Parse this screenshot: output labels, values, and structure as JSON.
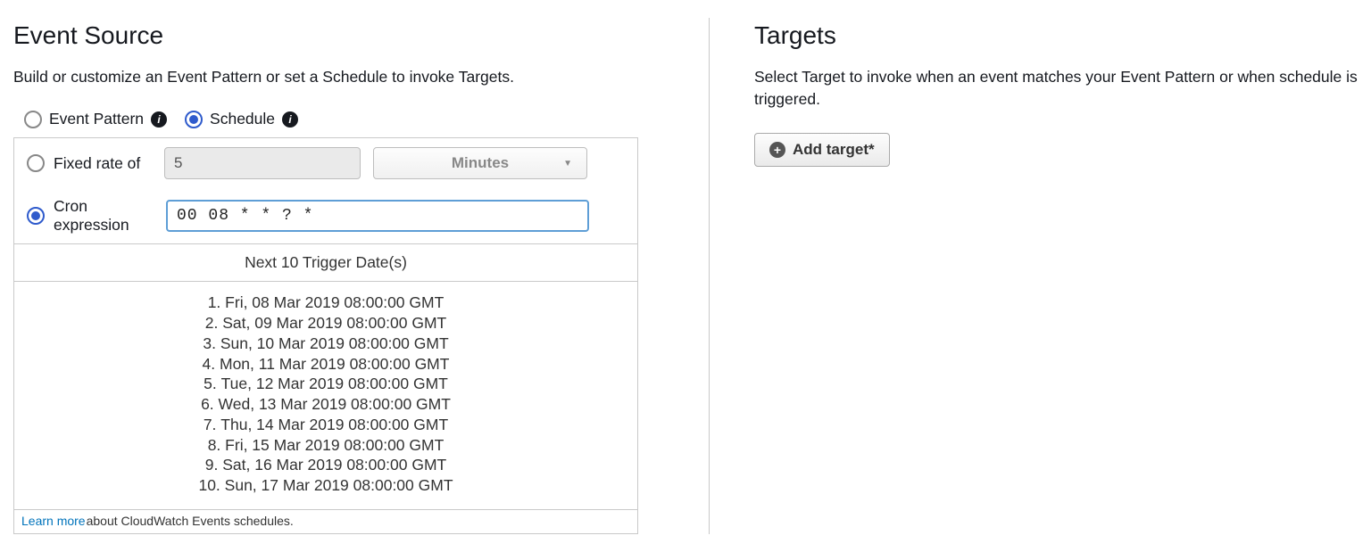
{
  "eventSource": {
    "title": "Event Source",
    "description": "Build or customize an Event Pattern or set a Schedule to invoke Targets.",
    "patternLabel": "Event Pattern",
    "scheduleLabel": "Schedule",
    "fixedRateLabel": "Fixed rate of",
    "fixedRateValue": "5",
    "fixedRateUnit": "Minutes",
    "cronLabel": "Cron expression",
    "cronValue": "00 08 * * ? *",
    "triggersHeader": "Next 10 Trigger Date(s)",
    "triggers": [
      "Fri, 08 Mar 2019 08:00:00 GMT",
      "Sat, 09 Mar 2019 08:00:00 GMT",
      "Sun, 10 Mar 2019 08:00:00 GMT",
      "Mon, 11 Mar 2019 08:00:00 GMT",
      "Tue, 12 Mar 2019 08:00:00 GMT",
      "Wed, 13 Mar 2019 08:00:00 GMT",
      "Thu, 14 Mar 2019 08:00:00 GMT",
      "Fri, 15 Mar 2019 08:00:00 GMT",
      "Sat, 16 Mar 2019 08:00:00 GMT",
      "Sun, 17 Mar 2019 08:00:00 GMT"
    ],
    "learnMoreLink": "Learn more",
    "learnMoreText": "about CloudWatch Events schedules."
  },
  "targets": {
    "title": "Targets",
    "description": "Select Target to invoke when an event matches your Event Pattern or when schedule is triggered.",
    "addButton": "Add target*"
  }
}
